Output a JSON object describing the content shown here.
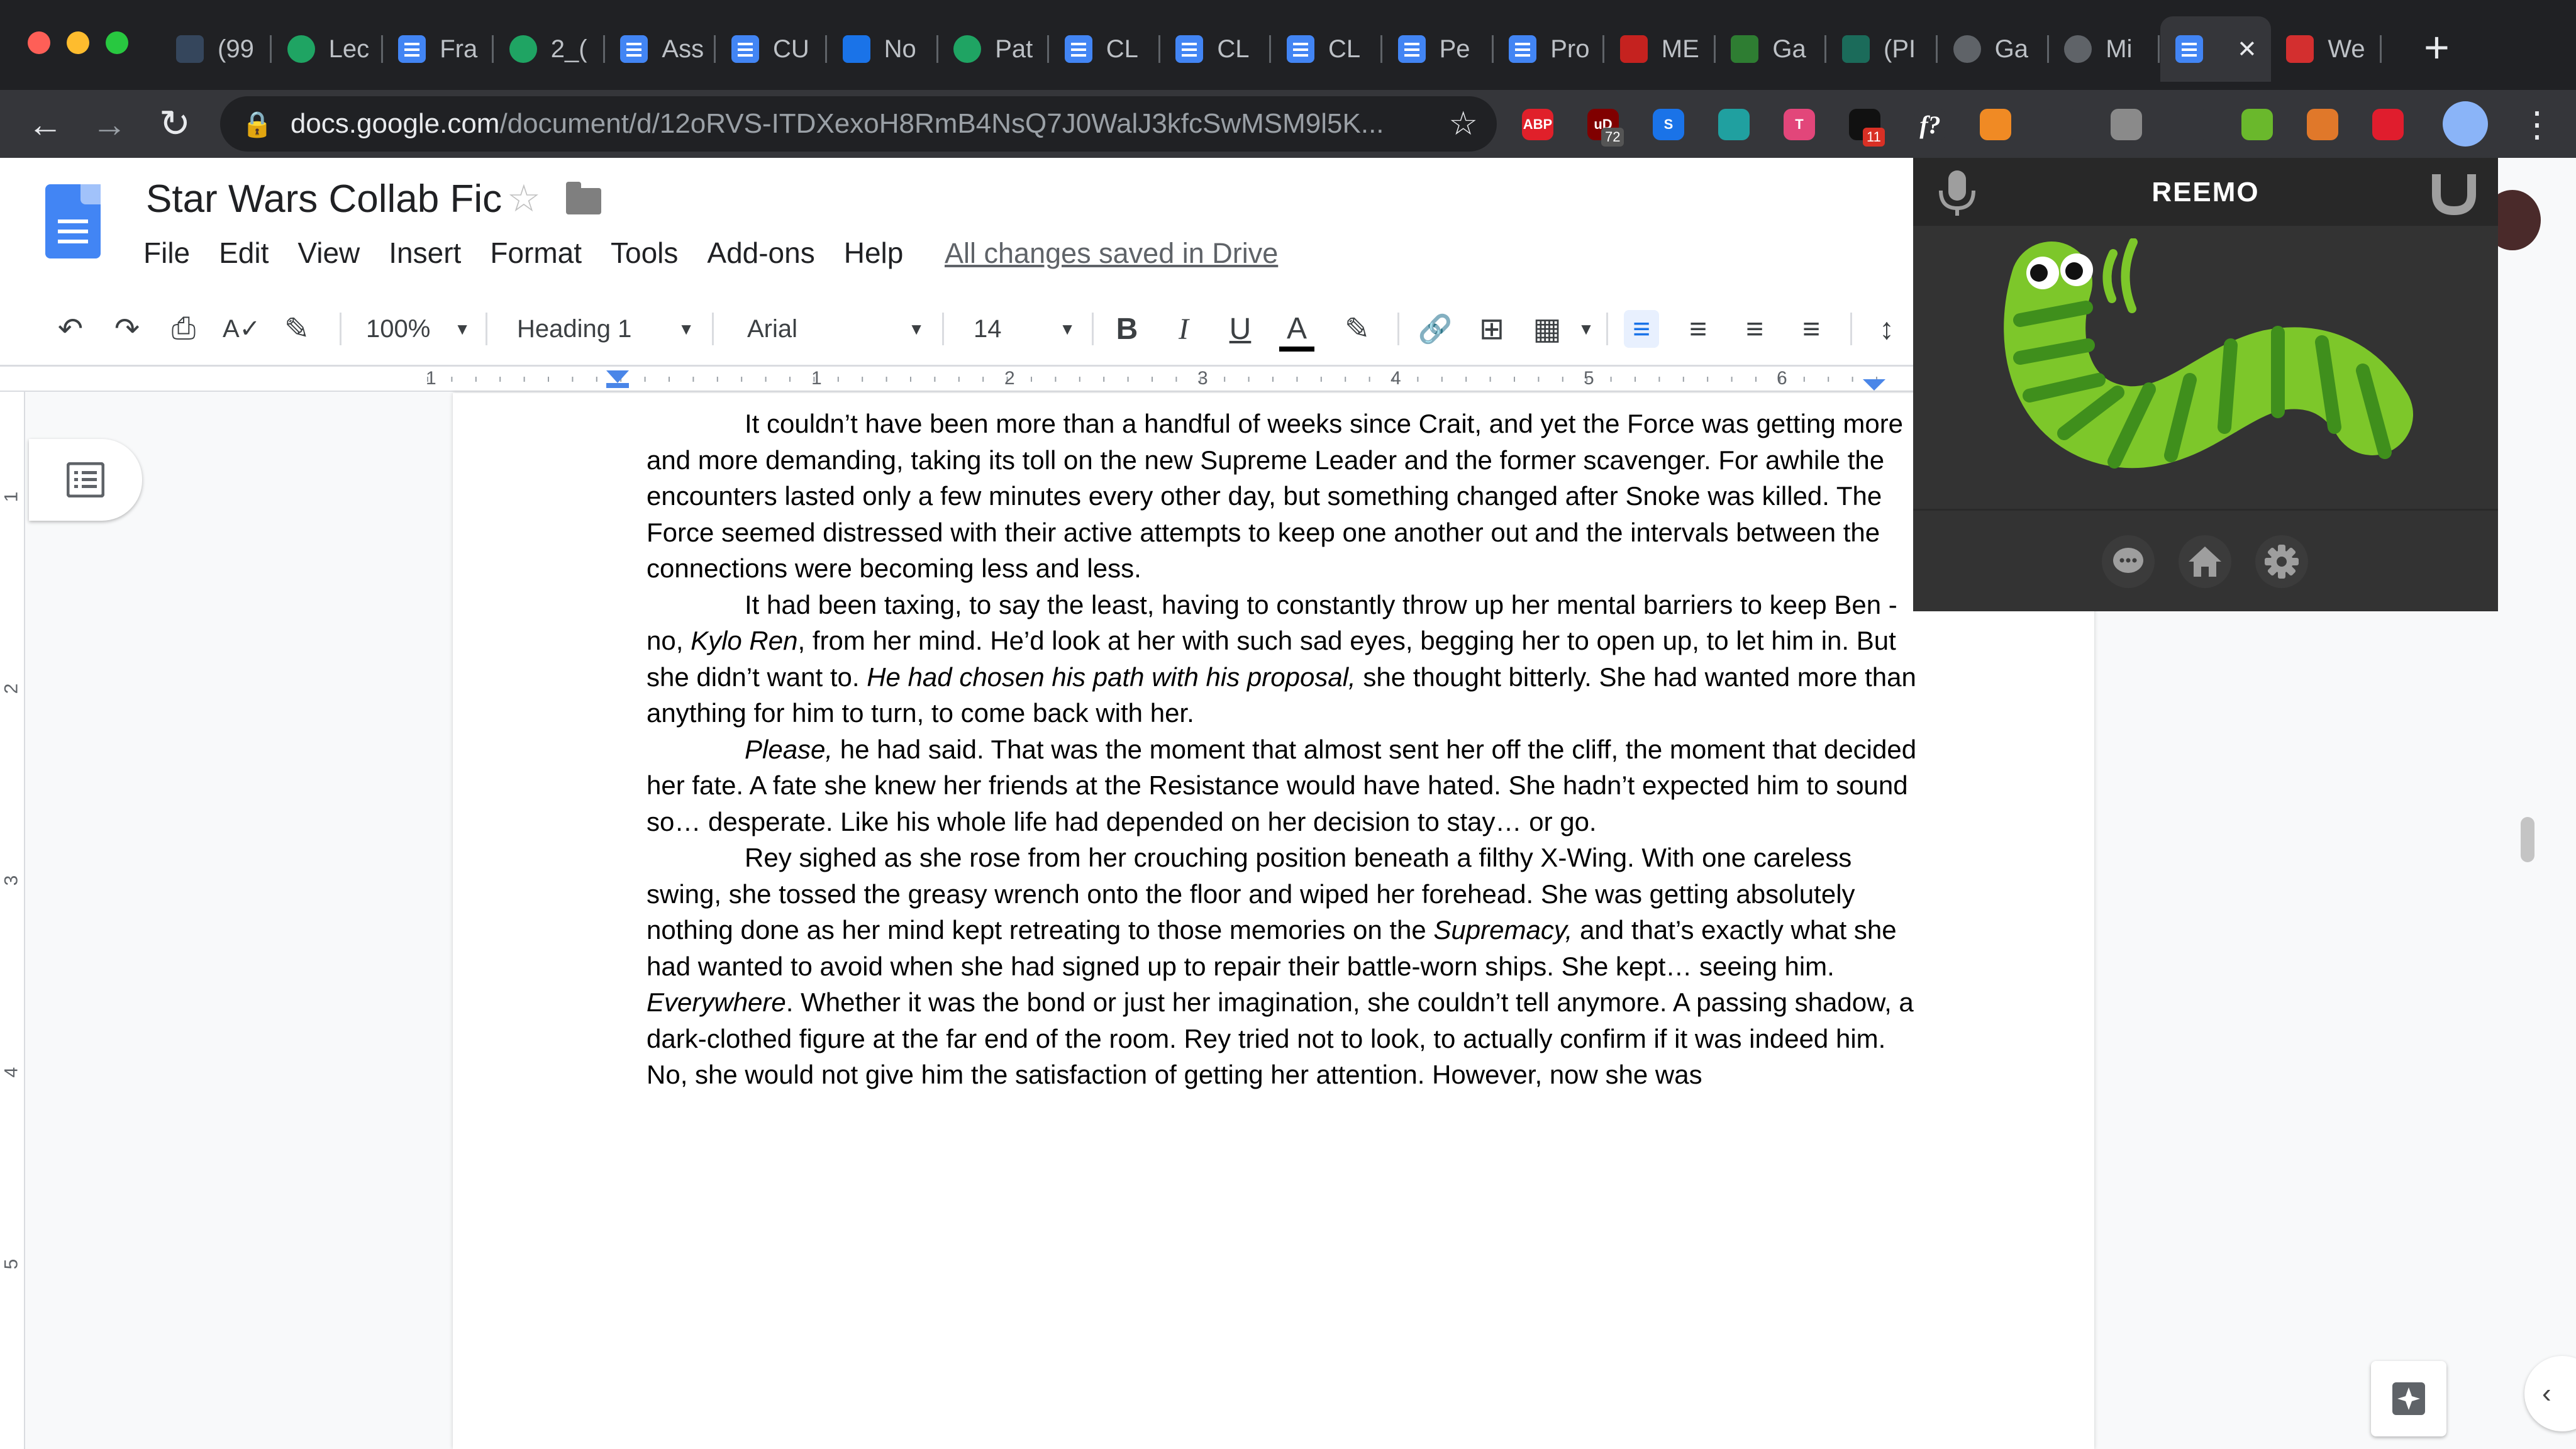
{
  "browser": {
    "tabs": [
      {
        "label": "(99",
        "icon": "tumblr-icon"
      },
      {
        "label": "Lec",
        "icon": "google-drive-icon"
      },
      {
        "label": "Fra",
        "icon": "google-docs-icon"
      },
      {
        "label": "2_(",
        "icon": "google-drive-icon"
      },
      {
        "label": "Ass",
        "icon": "google-docs-icon"
      },
      {
        "label": "CU",
        "icon": "google-docs-icon"
      },
      {
        "label": "No",
        "icon": "calendar-icon"
      },
      {
        "label": "Pat",
        "icon": "google-drive-icon"
      },
      {
        "label": "CL",
        "icon": "google-docs-icon"
      },
      {
        "label": "CL",
        "icon": "google-docs-icon"
      },
      {
        "label": "CL",
        "icon": "google-docs-icon"
      },
      {
        "label": "Pe",
        "icon": "google-docs-icon"
      },
      {
        "label": "Pro",
        "icon": "google-docs-icon"
      },
      {
        "label": "ME",
        "icon": "m-red-icon"
      },
      {
        "label": "Ga",
        "icon": "smiley-icon"
      },
      {
        "label": "(PI",
        "icon": "r-icon"
      },
      {
        "label": "Ga",
        "icon": "globe-icon"
      },
      {
        "label": "Mi",
        "icon": "globe-icon"
      },
      {
        "label": "",
        "icon": "google-docs-icon",
        "active": true
      },
      {
        "label": "We",
        "icon": "jar-icon"
      }
    ],
    "url_host": "docs.google.com",
    "url_path": "/document/d/12oRVS-ITDXexoH8RmB4NsQ7J0WalJ3kfcSwMSM9l5K...",
    "extensions": [
      {
        "name": "adblock-plus-icon",
        "text": "ABP",
        "color": "#e0202a"
      },
      {
        "name": "ublock-icon",
        "text": "uD",
        "color": "#800000",
        "badge": "72"
      },
      {
        "name": "s-extension-icon",
        "text": "S",
        "color": "#1a73e8"
      },
      {
        "name": "palette-extension-icon",
        "text": "",
        "color": "#20a0a0"
      },
      {
        "name": "t-extension-icon",
        "text": "T",
        "color": "#e2467a"
      },
      {
        "name": "camera-extension-icon",
        "text": "",
        "color": "#111111",
        "badge": "11"
      },
      {
        "name": "function-extension-icon",
        "text": "f?",
        "color": "#35363a"
      },
      {
        "name": "honey-extension-icon",
        "text": "",
        "color": "#f08a24"
      },
      {
        "name": "diamond-extension-icon",
        "text": "",
        "color": "#35363a"
      },
      {
        "name": "briefcase-extension-icon",
        "text": "",
        "color": "#8a8a8a"
      },
      {
        "name": "clock-extension-icon",
        "text": "",
        "color": "#35363a"
      },
      {
        "name": "worm-extension-icon",
        "text": "",
        "color": "#6ab82c"
      },
      {
        "name": "chart-extension-icon",
        "text": "",
        "color": "#e0782a"
      },
      {
        "name": "video-extension-icon",
        "text": "",
        "color": "#e01d2d"
      }
    ]
  },
  "doc": {
    "title": "Star Wars Collab Fic",
    "menu": [
      "File",
      "Edit",
      "View",
      "Insert",
      "Format",
      "Tools",
      "Add-ons",
      "Help"
    ],
    "save_status": "All changes saved in Drive",
    "zoom": "100%",
    "style": "Heading 1",
    "font": "Arial",
    "font_size": "14",
    "ruler_numbers": [
      "1",
      "1",
      "2",
      "3",
      "4",
      "5",
      "6"
    ],
    "vruler_numbers": [
      "1",
      "2",
      "3",
      "4",
      "5"
    ],
    "paragraphs": [
      [
        {
          "t": "It couldn’t have been more than a handful of weeks since Crait, and yet the Force was getting more and more demanding, taking its toll on the new Supreme Leader and the former scavenger. For awhile the encounters lasted only a few minutes every other day, but something changed after Snoke was killed. The Force seemed distressed with their active attempts to keep one another out and the intervals between the connections were becoming less and less."
        }
      ],
      [
        {
          "t": "It had been taxing, to say the least, having to constantly throw up her mental barriers to keep Ben - no, "
        },
        {
          "t": "Kylo Ren",
          "i": true
        },
        {
          "t": ", from her mind. He’d look at her with such sad eyes, begging her to open up, to let him in. But she didn’t want to. "
        },
        {
          "t": "He had chosen his path with his proposal,",
          "i": true
        },
        {
          "t": " she thought bitterly. She had wanted more than anything for him to turn, to come back with her."
        }
      ],
      [
        {
          "t": "Please,",
          "i": true
        },
        {
          "t": " he had said. That was the moment that almost sent her off the cliff, the moment that decided her fate. A fate she knew her friends at the Resistance would have hated. She hadn’t expected him to sound so… desperate. Like his whole life had depended on her decision to stay… or go."
        }
      ],
      [
        {
          "t": "Rey sighed as she rose from her crouching position beneath a filthy X-Wing. With one careless swing, she tossed the greasy wrench onto the floor and wiped her forehead. She was getting absolutely nothing done as her mind kept retreating to those memories on the "
        },
        {
          "t": "Supremacy,",
          "i": true
        },
        {
          "t": " and that’s exactly what she had wanted to avoid when she had signed up to repair their battle-worn ships. She kept… seeing him. "
        },
        {
          "t": "Everywhere",
          "i": true
        },
        {
          "t": ". Whether it was the bond or just her imagination, she couldn’t tell anymore. A passing shadow, a dark-clothed figure at the far end of the room. Rey tried not to look, to actually confirm if it was indeed him. No, she would not give him the satisfaction of getting her attention. However, now she was"
        }
      ]
    ]
  },
  "reemo": {
    "brand": "REEMO"
  },
  "colors": {
    "docs_blue": "#4285f4",
    "worm_green": "#7dc72a",
    "worm_stripe": "#3f8f1c",
    "chrome_dark": "#202124"
  }
}
